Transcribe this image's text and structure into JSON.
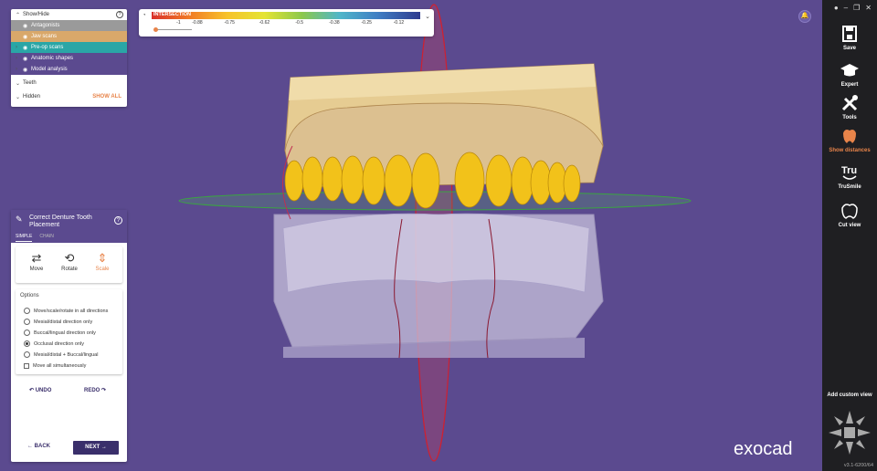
{
  "showhide": {
    "header": "Show/Hide",
    "items": [
      {
        "label": "Antagonists",
        "bg": "#9a9a9a"
      },
      {
        "label": "Jaw scans",
        "bg": "#d9a86a"
      },
      {
        "label": "Pre-op scans",
        "bg": "#2aa6a6"
      },
      {
        "label": "Anatomic shapes",
        "bg": "#5b4a8f"
      },
      {
        "label": "Model analysis",
        "bg": "#5b4a8f"
      }
    ],
    "teeth": "Teeth",
    "hidden": "Hidden",
    "show_all": "SHOW ALL"
  },
  "legend": {
    "title": "INTERSECTION",
    "ticks": [
      "-1",
      "-0.88",
      "-0.75",
      "-0.62",
      "-0.5",
      "-0.38",
      "-0.25",
      "-0.12"
    ]
  },
  "wizard": {
    "title": "Correct Denture Tooth Placement",
    "tabs": [
      "SIMPLE",
      "CHAIN"
    ],
    "modes": [
      "Move",
      "Rotate",
      "Scale"
    ],
    "options_label": "Options",
    "options": [
      "Move/scale/rotate in all directions",
      "Mesial/distal direction only",
      "Buccal/lingual direction only",
      "Occlusal direction only",
      "Mesial/distal + Buccal/lingual"
    ],
    "selected_option": 3,
    "checkbox_label": "Move all simultaneously",
    "undo": "UNDO",
    "redo": "REDO",
    "back": "BACK",
    "next": "NEXT"
  },
  "toolbar": {
    "save": "Save",
    "expert": "Expert",
    "tools": "Tools",
    "show_distances": "Show distances",
    "trusmile": "TruSmile",
    "cut_view": "Cut view",
    "add_custom_view": "Add custom view",
    "version": "v3.1-6200/64"
  },
  "logo": "exocad"
}
